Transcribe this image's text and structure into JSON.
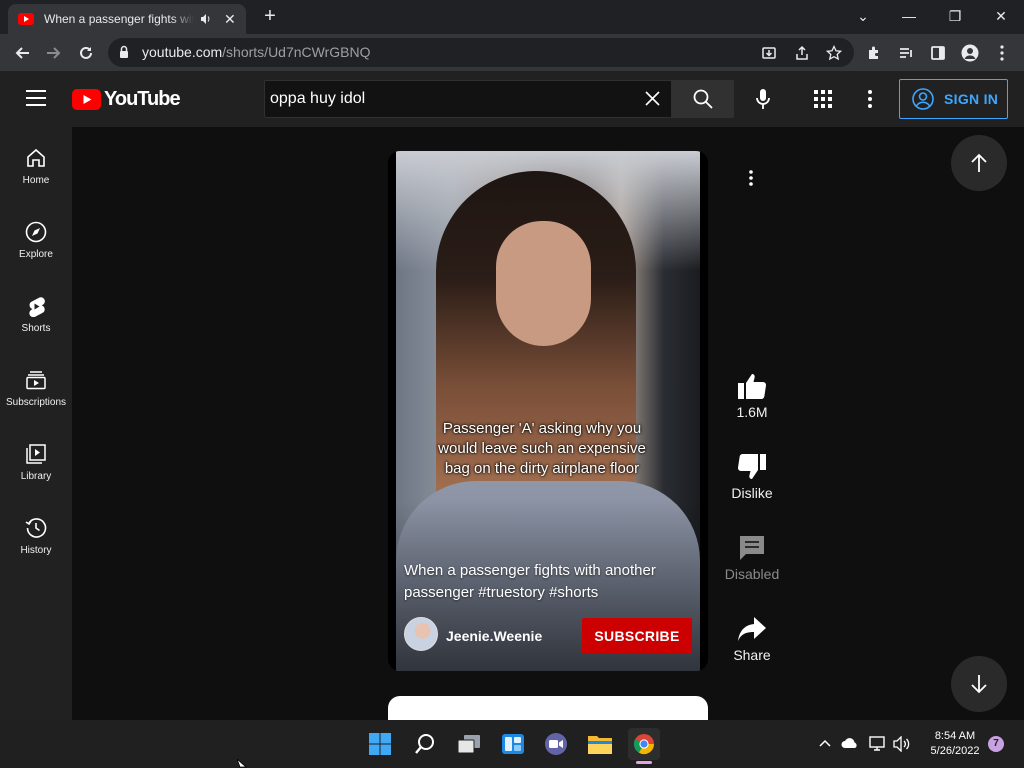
{
  "browser": {
    "tab_title": "When a passenger fights with another passenger #truestory #shorts",
    "url_host": "youtube.com",
    "url_path": "/shorts/Ud7nCWrGBNQ",
    "window_controls": [
      "chevron-down-icon",
      "minimize-icon",
      "restore-icon",
      "close-icon"
    ]
  },
  "youtube": {
    "logo_text": "YouTube",
    "search_value": "oppa huy idol",
    "sign_in_label": "SIGN IN",
    "colors": {
      "brand_red": "#ff0000",
      "subscribe_red": "#cc0000",
      "sign_in_blue": "#3ea6ff"
    }
  },
  "sidebar": {
    "items": [
      {
        "label": "Home",
        "icon": "home-icon"
      },
      {
        "label": "Explore",
        "icon": "compass-icon"
      },
      {
        "label": "Shorts",
        "icon": "shorts-icon"
      },
      {
        "label": "Subscriptions",
        "icon": "subscriptions-icon"
      },
      {
        "label": "Library",
        "icon": "library-icon"
      },
      {
        "label": "History",
        "icon": "history-icon"
      }
    ]
  },
  "short": {
    "caption": "Passenger 'A' asking why you would leave such an expensive bag on the dirty airplane floor",
    "title": "When a passenger fights with another passenger #truestory #shorts",
    "channel": "Jeenie.Weenie",
    "subscribe_label": "SUBSCRIBE"
  },
  "actions": {
    "like_count": "1.6M",
    "dislike_label": "Dislike",
    "comments_label": "Disabled",
    "share_label": "Share"
  },
  "taskbar": {
    "time": "8:54 AM",
    "date": "5/26/2022",
    "notification_count": "7"
  }
}
